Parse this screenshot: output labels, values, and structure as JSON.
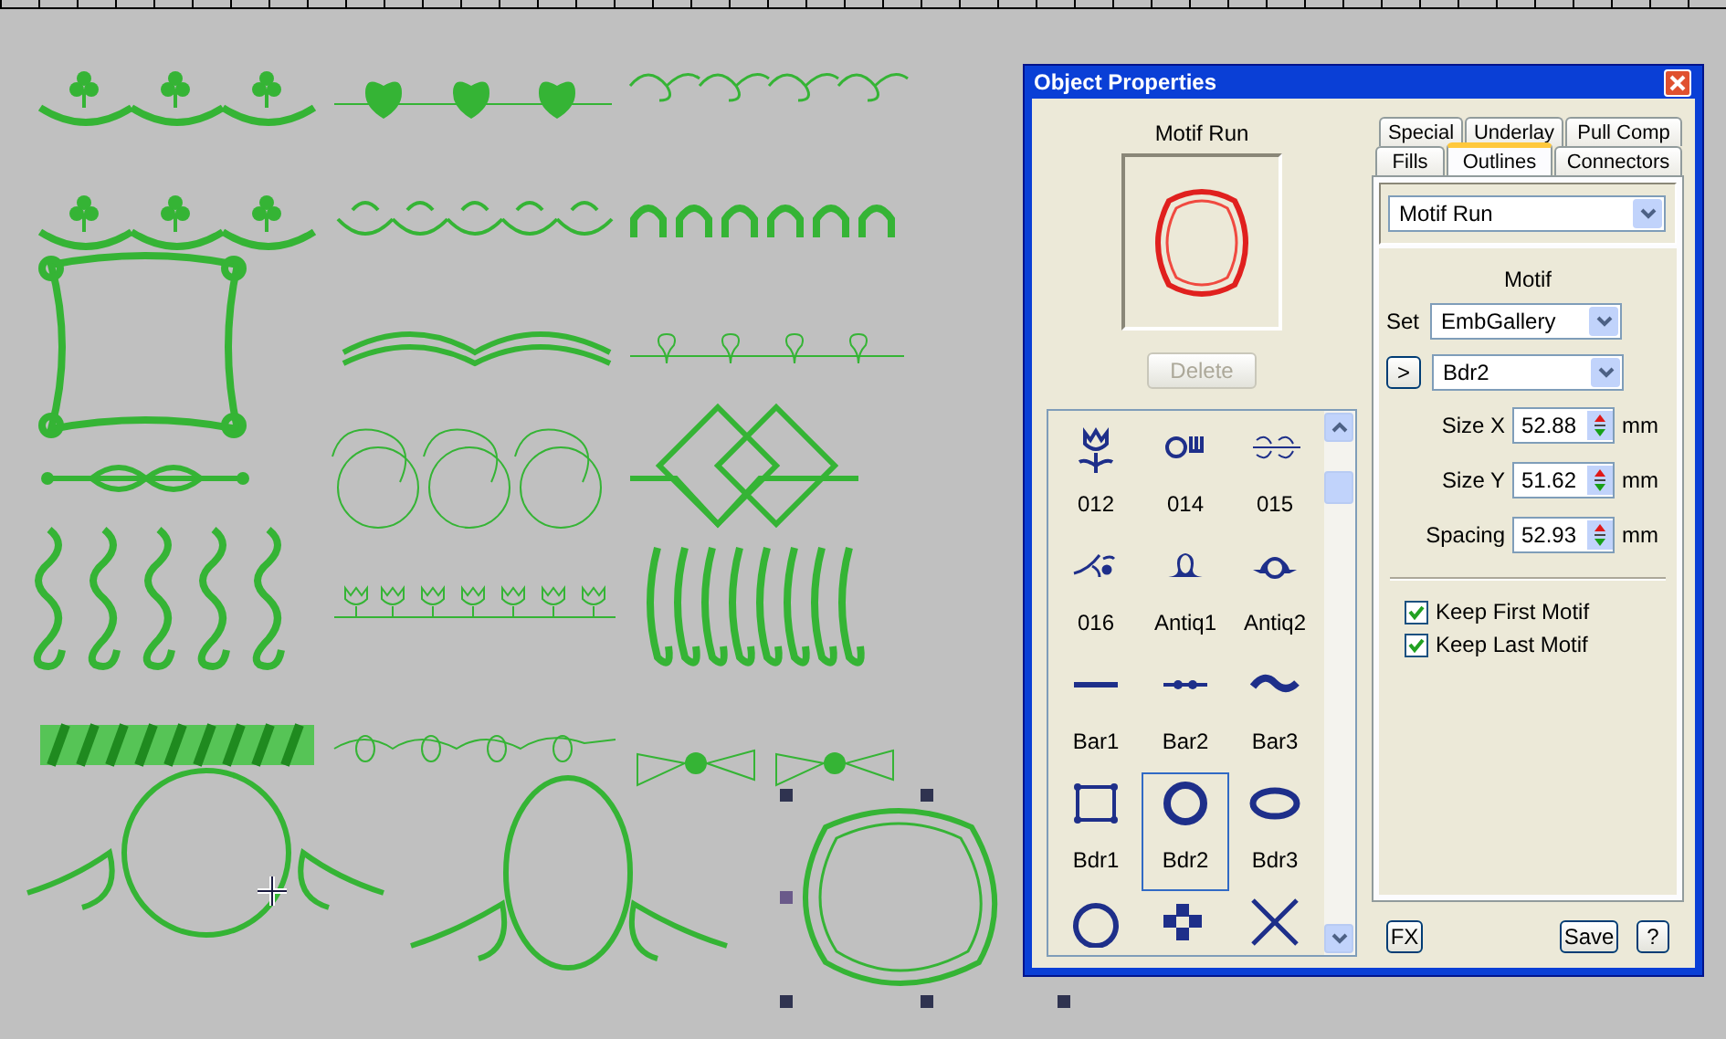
{
  "dialog": {
    "title": "Object Properties",
    "preview_label": "Motif Run",
    "delete_button": {
      "label": "Delete",
      "disabled": true
    },
    "motif_list": [
      {
        "label": "012",
        "selected": false
      },
      {
        "label": "014",
        "selected": false
      },
      {
        "label": "015",
        "selected": false
      },
      {
        "label": "016",
        "selected": false
      },
      {
        "label": "Antiq1",
        "selected": false
      },
      {
        "label": "Antiq2",
        "selected": false
      },
      {
        "label": "Bar1",
        "selected": false
      },
      {
        "label": "Bar2",
        "selected": false
      },
      {
        "label": "Bar3",
        "selected": false
      },
      {
        "label": "Bdr1",
        "selected": false
      },
      {
        "label": "Bdr2",
        "selected": true
      },
      {
        "label": "Bdr3",
        "selected": false
      },
      {
        "selected": false
      },
      {
        "selected": false
      },
      {
        "selected": false
      }
    ],
    "tabs_back": [
      {
        "label": "Special",
        "selected": false
      },
      {
        "label": "Underlay",
        "selected": false
      },
      {
        "label": "Pull Comp",
        "selected": false
      }
    ],
    "tabs_front": [
      {
        "label": "Fills",
        "selected": false
      },
      {
        "label": "Outlines",
        "selected": true
      },
      {
        "label": "Connectors",
        "selected": false
      }
    ],
    "stitch_type": "Motif Run",
    "motif_heading": "Motif",
    "set": {
      "label": "Set",
      "value": "EmbGallery"
    },
    "next_button": ">",
    "pattern": "Bdr2",
    "fields": [
      {
        "label": "Size X",
        "value": "52.88",
        "unit": "mm"
      },
      {
        "label": "Size Y",
        "value": "51.62",
        "unit": "mm"
      },
      {
        "label": "Spacing",
        "value": "52.93",
        "unit": "mm"
      }
    ],
    "checkboxes": [
      {
        "label": "Keep First Motif",
        "checked": true
      },
      {
        "label": "Keep Last Motif",
        "checked": true
      }
    ],
    "buttons": {
      "fx": "FX",
      "save": "Save",
      "help": "?"
    }
  }
}
